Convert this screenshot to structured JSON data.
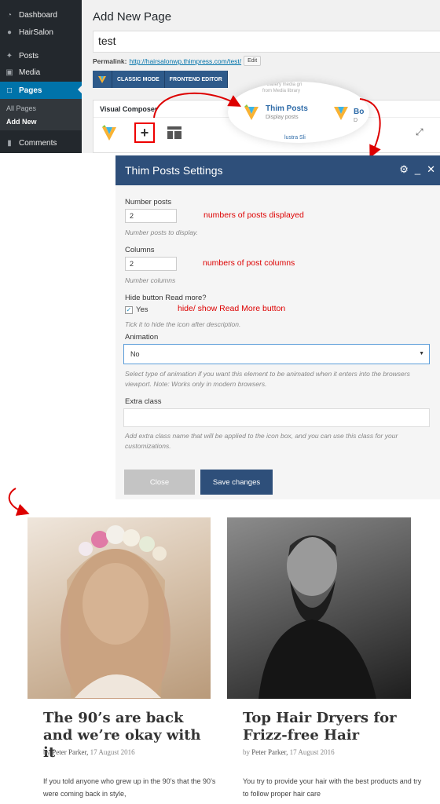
{
  "sidebar": {
    "items": [
      {
        "label": "Dashboard",
        "icon": "dashboard-icon"
      },
      {
        "label": "HairSalon",
        "icon": "hairsalon-icon"
      },
      {
        "label": "Posts",
        "icon": "pin-icon"
      },
      {
        "label": "Media",
        "icon": "media-icon"
      },
      {
        "label": "Pages",
        "icon": "pages-icon"
      },
      {
        "label": "Comments",
        "icon": "comments-icon"
      }
    ],
    "submenu": [
      "All Pages",
      "Add New"
    ]
  },
  "editor": {
    "heading": "Add New Page",
    "title_value": "test",
    "permalink_label": "Permalink:",
    "permalink_url": "http://hairsalonwp.thimpress.com/test/",
    "edit_button": "Edit",
    "classic_mode": "CLASSIC MODE",
    "frontend_editor": "FRONTEND EDITOR",
    "vc_title": "Visual Composer"
  },
  "popup": {
    "item_title": "Thim Posts",
    "item_desc": "Display posts",
    "behind_text_1": "a Gallery media gri",
    "behind_text_2": "from Media library",
    "next_item_title": "Bo",
    "next_item_desc": "D",
    "bottom_text": "lustra Sli"
  },
  "modal": {
    "title": "Thim Posts Settings",
    "number_posts_label": "Number posts",
    "number_posts_value": "2",
    "number_posts_hint": "Number posts to display.",
    "columns_label": "Columns",
    "columns_value": "2",
    "columns_hint": "Number columns",
    "hide_label": "Hide button Read more?",
    "hide_checkbox_label": "Yes",
    "hide_hint": "Tick it to hide the icon after description.",
    "animation_label": "Animation",
    "animation_value": "No",
    "animation_hint": "Select type of animation if you want this element to be animated when it enters into the browsers viewport. Note: Works only in modern browsers.",
    "extra_label": "Extra class",
    "extra_hint": "Add extra class name that will be applied to the icon box, and you can use this class for your customizations.",
    "close_button": "Close",
    "save_button": "Save changes"
  },
  "annotations": {
    "number_posts": "numbers of posts displayed",
    "columns": "numbers of post columns",
    "hide_button": "hide/ show Read More button"
  },
  "posts": [
    {
      "title": "The 90’s are back and we’re okay with it",
      "meta_by": "by",
      "meta_author": "Peter Parker,",
      "meta_date": "17 August 2016",
      "excerpt": "If you told anyone who grew up in the 90’s that the 90’s were coming back in style,"
    },
    {
      "title": "Top Hair Dryers for Frizz-free Hair",
      "meta_by": "by",
      "meta_author": "Peter Parker,",
      "meta_date": "17 August 2016",
      "excerpt": "You try to provide your hair with the best products and try to follow proper hair care"
    }
  ],
  "colors": {
    "wp_sidebar": "#23282d",
    "wp_active": "#0073aa",
    "modal_header": "#2e4f7a",
    "save_button": "#2e4f7a",
    "annotation_red": "#dd0000"
  }
}
